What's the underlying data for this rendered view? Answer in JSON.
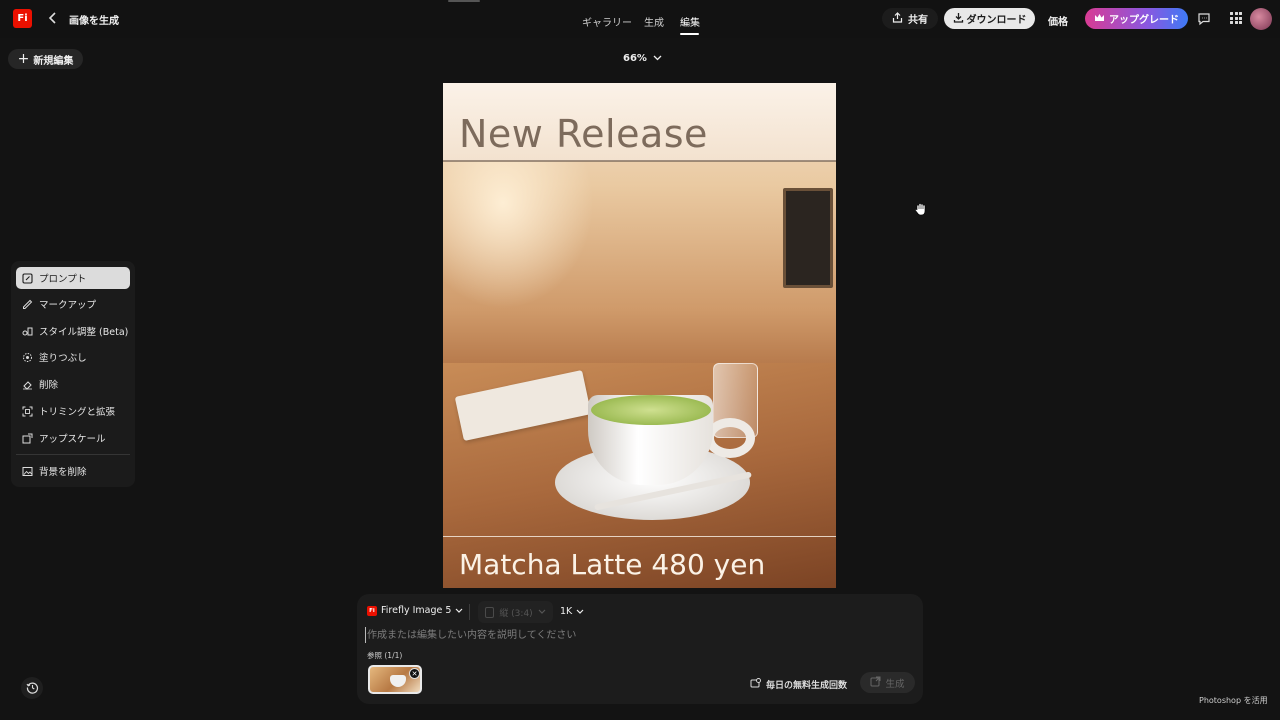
{
  "header": {
    "app_logo": "Fi",
    "title": "画像を生成",
    "tabs": [
      {
        "label": "ギャラリー"
      },
      {
        "label": "生成"
      },
      {
        "label": "編集"
      }
    ],
    "share_label": "共有",
    "download_label": "ダウンロード",
    "price_label": "価格",
    "upgrade_label": "アップグレード",
    "colors": {
      "logo": "#eb1000",
      "upgrade_start": "#d93c93",
      "upgrade_end": "#3e7af5"
    }
  },
  "toolbar": {
    "new_edit_label": "新規編集",
    "zoom": "66%"
  },
  "canvas": {
    "headline": "New Release",
    "caption": "Matcha Latte 480 yen"
  },
  "tools": {
    "items": [
      {
        "label": "プロンプト",
        "icon": "prompt-edit-icon"
      },
      {
        "label": "マークアップ",
        "icon": "markup-pen-icon"
      },
      {
        "label": "スタイル調整 (Beta)",
        "icon": "style-adjust-icon"
      },
      {
        "label": "塗りつぶし",
        "icon": "fill-icon"
      },
      {
        "label": "削除",
        "icon": "eraser-icon"
      },
      {
        "label": "トリミングと拡張",
        "icon": "crop-expand-icon"
      },
      {
        "label": "アップスケール",
        "icon": "upscale-icon"
      },
      {
        "label": "背景を削除",
        "icon": "remove-background-icon"
      }
    ],
    "active_index": 0
  },
  "prompt_panel": {
    "model": "Firefly Image 5",
    "model_logo": "Fi",
    "aspect": "縦 (3:4)",
    "resolution": "1K",
    "placeholder": "作成または編集したい内容を説明してください",
    "reference_label": "参照 (1/1)",
    "free_generations_label": "毎日の無料生成回数",
    "generate_label": "生成"
  },
  "footer": {
    "note": "Photoshop を活用"
  }
}
